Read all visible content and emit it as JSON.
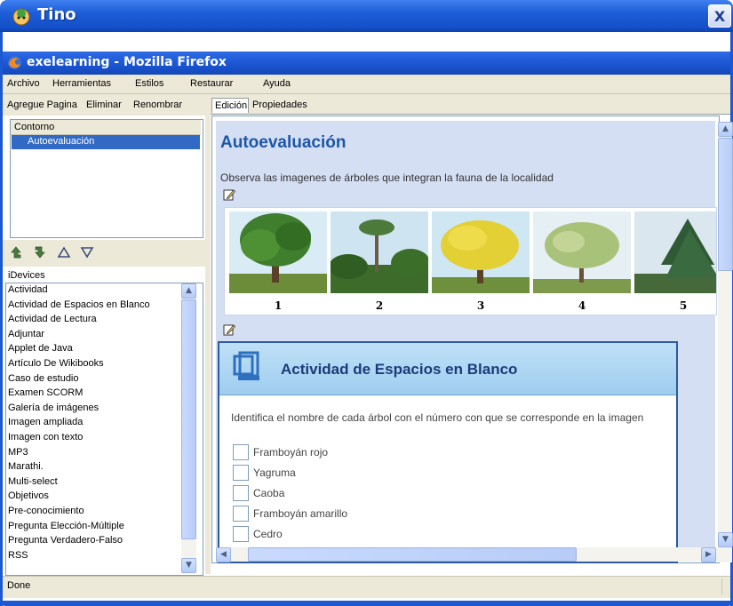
{
  "outer_window": {
    "title": "Tino",
    "close_label": "X"
  },
  "browser": {
    "title": "exelearning - Mozilla Firefox"
  },
  "menu": [
    "Archivo",
    "Herramientas",
    "Estilos",
    "Restaurar",
    "Ayuda"
  ],
  "left_toolbar": {
    "add_page": "Agregue Pagina",
    "delete": "Eliminar",
    "rename": "Renombrar"
  },
  "outline": {
    "header": "Contorno",
    "selected_item": "Autoevaluación"
  },
  "idevices": {
    "label": "iDevices",
    "items": [
      "Actividad",
      "Actividad de Espacios en Blanco",
      "Actividad de Lectura",
      "Adjuntar",
      "Applet de Java",
      "Artículo De Wikibooks",
      "Caso de estudio",
      "Examen SCORM",
      "Galería de imágenes",
      "Imagen ampliada",
      "Imagen con texto",
      "MP3",
      "Marathi.",
      "Multi-select",
      "Objetivos",
      "Pre-conocimiento",
      "Pregunta Elección-Múltiple",
      "Pregunta Verdadero-Falso",
      "RSS"
    ]
  },
  "tabs": {
    "edit": "Edición",
    "properties": "Propiedades"
  },
  "content": {
    "title": "Autoevaluación",
    "intro": "Observa las imagenes de árboles que integran la fauna de la localidad",
    "gallery_numbers": [
      "1",
      "2",
      "3",
      "4",
      "5"
    ]
  },
  "activity": {
    "title": "Actividad de Espacios en Blanco",
    "instructions": "Identifica el nombre de cada árbol con el número con que se corresponde en la imagen",
    "blanks": [
      "Framboyán rojo",
      "Yagruma",
      "Caoba",
      "Framboyán amarillo",
      "Cedro"
    ]
  },
  "status": {
    "text": "Done"
  },
  "colors": {
    "xp_blue": "#1d5ed8",
    "selection": "#316ac5",
    "title_blue": "#1c56a6",
    "activity_header": "#bfe1f7"
  }
}
